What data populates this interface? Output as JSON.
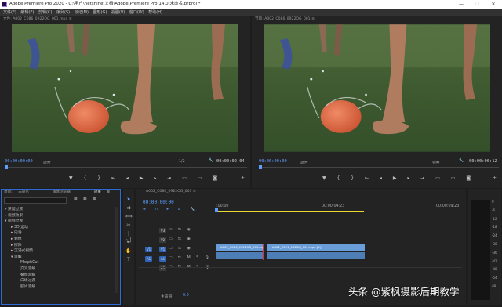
{
  "window": {
    "title": "Adobe Premiere Pro 2020 - C:\\用户\\netshine\\文档\\Adobe\\Premiere Pro\\14.0\\未命名.prproj *",
    "min": "—",
    "max": "☐",
    "close": "✕"
  },
  "menu": [
    "文件(F)",
    "编辑(E)",
    "剪辑(C)",
    "序列(S)",
    "标记(M)",
    "图形(G)",
    "视图(V)",
    "窗口(W)",
    "帮助(H)"
  ],
  "source_monitor": {
    "tab": "文件: A002_C086_0922OG_001.mp4 ≡",
    "timecode": "00:00:00:00",
    "zoom": "适合",
    "page": "1/2",
    "duration": "00:00:02:04"
  },
  "program_monitor": {
    "tab": "节目: A002_C086_0922OG_001 ≡",
    "timecode": "00:00:00:00",
    "zoom": "适合",
    "quality": "完整",
    "duration": "00:00:06:12"
  },
  "project_panel": {
    "tabs": [
      "项目: 未命名",
      "媒体浏览器",
      "效果 ≡"
    ],
    "tree": [
      {
        "label": "▸ 蒸馏过渡",
        "indent": 0
      },
      {
        "label": "▸ 视频效果",
        "indent": 0
      },
      {
        "label": "▾ 视频过渡",
        "indent": 0
      },
      {
        "label": "▸ 3D 运动",
        "indent": 1
      },
      {
        "label": "▸ 内滑",
        "indent": 1
      },
      {
        "label": "▸ 划像",
        "indent": 1
      },
      {
        "label": "▸ 擦除",
        "indent": 1
      },
      {
        "label": "▸ 沉浸式视频",
        "indent": 1
      },
      {
        "label": "▾ 溶解",
        "indent": 1
      },
      {
        "label": "MorphCut",
        "indent": 2
      },
      {
        "label": "交叉溶解",
        "indent": 2
      },
      {
        "label": "叠加溶解",
        "indent": 2
      },
      {
        "label": "白场过渡",
        "indent": 2
      },
      {
        "label": "胶片溶解",
        "indent": 2
      }
    ]
  },
  "timeline": {
    "tab": "A002_C086_0922OG_001 ≡",
    "timecode": "00:00:00:00",
    "ruler": [
      ":00:00",
      "00:00:04:23",
      "00:00:09:23"
    ],
    "tracks": [
      {
        "name": "V3",
        "src": ""
      },
      {
        "name": "V2",
        "src": ""
      },
      {
        "name": "V1",
        "src": "V1"
      },
      {
        "name": "A1",
        "src": "A1"
      },
      {
        "name": "A2",
        "src": ""
      }
    ],
    "master_label": "主声道",
    "master_value": "0.0",
    "clips": [
      "A002_C086_0922OG_001.mp4",
      "A002_C021_0923KJ_001.mp4 [V]"
    ]
  },
  "meter_scale": [
    "0",
    "-6",
    "-12",
    "-18",
    "-24",
    "-30",
    "-36",
    "-42",
    "-48",
    "-54",
    "dB"
  ],
  "watermark": "头条 @紫枫摄影后期教学",
  "colors": {
    "accent": "#5fa0ff",
    "clip": "#6a9ed8",
    "audio": "#4d7fb6",
    "playhead": "#d0323f"
  }
}
